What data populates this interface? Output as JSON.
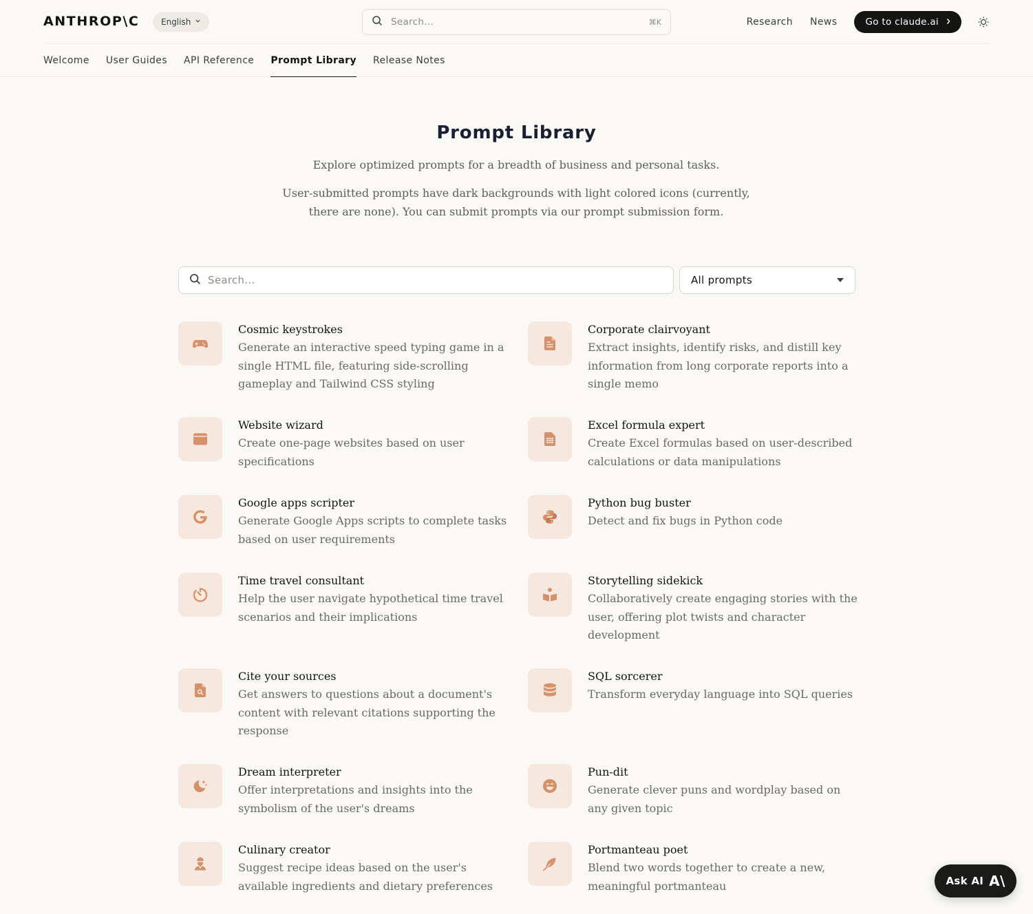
{
  "brand": {
    "logo_text": "ANTHROP\\C",
    "accent": "#d4916a",
    "icon_bg": "#f6e8de"
  },
  "header": {
    "language": "English",
    "search_placeholder": "Search...",
    "search_shortcut": "⌘K",
    "links": [
      "Research",
      "News"
    ],
    "cta_label": "Go to claude.ai",
    "theme_icon": "sun-icon"
  },
  "nav": {
    "tabs": [
      "Welcome",
      "User Guides",
      "API Reference",
      "Prompt Library",
      "Release Notes"
    ],
    "active": "Prompt Library"
  },
  "hero": {
    "title": "Prompt Library",
    "subtitle": "Explore optimized prompts for a breadth of business and personal tasks.",
    "description": "User-submitted prompts have dark backgrounds with light colored icons (currently, there are none). You can submit prompts via our prompt submission form."
  },
  "filters": {
    "search_placeholder": "Search...",
    "select_value": "All prompts"
  },
  "prompts": [
    {
      "title": "Cosmic keystrokes",
      "desc": "Generate an interactive speed typing game in a single HTML file, featuring side-scrolling gameplay and Tailwind CSS styling",
      "icon": "gamepad-icon"
    },
    {
      "title": "Corporate clairvoyant",
      "desc": "Extract insights, identify risks, and distill key information from long corporate reports into a single memo",
      "icon": "document-icon"
    },
    {
      "title": "Website wizard",
      "desc": "Create one-page websites based on user specifications",
      "icon": "browser-window-icon"
    },
    {
      "title": "Excel formula expert",
      "desc": "Create Excel formulas based on user-described calculations or data manipulations",
      "icon": "spreadsheet-icon"
    },
    {
      "title": "Google apps scripter",
      "desc": "Generate Google Apps scripts to complete tasks based on user requirements",
      "icon": "google-icon"
    },
    {
      "title": "Python bug buster",
      "desc": "Detect and fix bugs in Python code",
      "icon": "python-icon"
    },
    {
      "title": "Time travel consultant",
      "desc": "Help the user navigate hypothetical time travel scenarios and their implications",
      "icon": "timer-icon"
    },
    {
      "title": "Storytelling sidekick",
      "desc": "Collaboratively create engaging stories with the user, offering plot twists and character development",
      "icon": "book-reader-icon"
    },
    {
      "title": "Cite your sources",
      "desc": "Get answers to questions about a document's content with relevant citations supporting the response",
      "icon": "document-search-icon"
    },
    {
      "title": "SQL sorcerer",
      "desc": "Transform everyday language into SQL queries",
      "icon": "database-icon"
    },
    {
      "title": "Dream interpreter",
      "desc": "Offer interpretations and insights into the symbolism of the user's dreams",
      "icon": "moon-stars-icon"
    },
    {
      "title": "Pun-dit",
      "desc": "Generate clever puns and wordplay based on any given topic",
      "icon": "laughing-face-icon"
    },
    {
      "title": "Culinary creator",
      "desc": "Suggest recipe ideas based on the user's available ingredients and dietary preferences",
      "icon": "chef-icon"
    },
    {
      "title": "Portmanteau poet",
      "desc": "Blend two words together to create a new, meaningful portmanteau",
      "icon": "feather-icon"
    }
  ],
  "ask_ai": {
    "label": "Ask AI",
    "mark": "A\\"
  }
}
